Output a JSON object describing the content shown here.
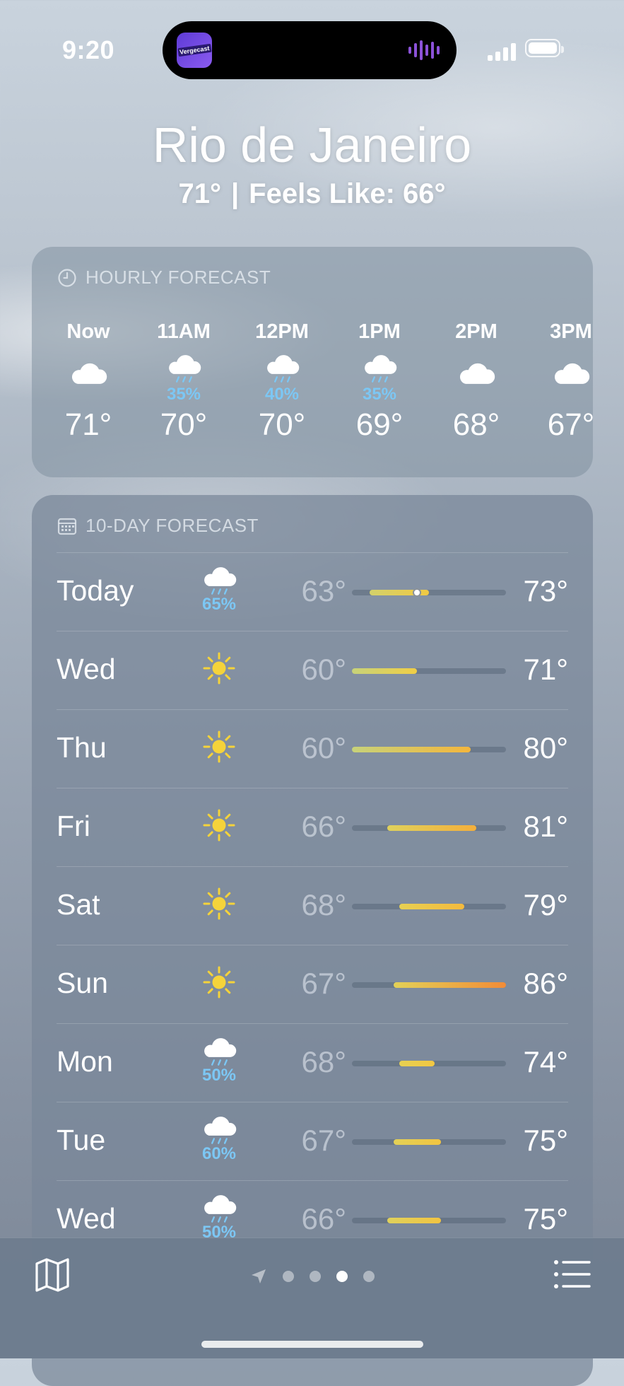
{
  "status_bar": {
    "time": "9:20",
    "live_activity_app": "Vergecast"
  },
  "location": {
    "city": "Rio de Janeiro",
    "current_temp": "71°",
    "separator": "|",
    "feels_like": "Feels Like: 66°"
  },
  "hourly": {
    "title": "HOURLY FORECAST",
    "icon": "clock-icon",
    "items": [
      {
        "label": "Now",
        "icon": "cloud-icon",
        "pop": "",
        "temp": "71°"
      },
      {
        "label": "11AM",
        "icon": "cloud-rain-icon",
        "pop": "35%",
        "temp": "70°"
      },
      {
        "label": "12PM",
        "icon": "cloud-rain-icon",
        "pop": "40%",
        "temp": "70°"
      },
      {
        "label": "1PM",
        "icon": "cloud-rain-icon",
        "pop": "35%",
        "temp": "69°"
      },
      {
        "label": "2PM",
        "icon": "cloud-icon",
        "pop": "",
        "temp": "68°"
      },
      {
        "label": "3PM",
        "icon": "cloud-icon",
        "pop": "",
        "temp": "67°"
      }
    ]
  },
  "daily": {
    "title": "10-DAY FORECAST",
    "icon": "calendar-icon",
    "range_min": 60,
    "range_max": 86,
    "days": [
      {
        "day": "Today",
        "icon": "cloud-rain-icon",
        "pop": "65%",
        "low": "63°",
        "high": "73°",
        "low_v": 63,
        "high_v": 73,
        "current_v": 71
      },
      {
        "day": "Wed",
        "icon": "sun-icon",
        "pop": "",
        "low": "60°",
        "high": "71°",
        "low_v": 60,
        "high_v": 71
      },
      {
        "day": "Thu",
        "icon": "sun-icon",
        "pop": "",
        "low": "60°",
        "high": "80°",
        "low_v": 60,
        "high_v": 80
      },
      {
        "day": "Fri",
        "icon": "sun-icon",
        "pop": "",
        "low": "66°",
        "high": "81°",
        "low_v": 66,
        "high_v": 81
      },
      {
        "day": "Sat",
        "icon": "sun-icon",
        "pop": "",
        "low": "68°",
        "high": "79°",
        "low_v": 68,
        "high_v": 79
      },
      {
        "day": "Sun",
        "icon": "sun-icon",
        "pop": "",
        "low": "67°",
        "high": "86°",
        "low_v": 67,
        "high_v": 86
      },
      {
        "day": "Mon",
        "icon": "cloud-rain-icon",
        "pop": "50%",
        "low": "68°",
        "high": "74°",
        "low_v": 68,
        "high_v": 74
      },
      {
        "day": "Tue",
        "icon": "cloud-rain-icon",
        "pop": "60%",
        "low": "67°",
        "high": "75°",
        "low_v": 67,
        "high_v": 75
      },
      {
        "day": "Wed",
        "icon": "cloud-rain-icon",
        "pop": "50%",
        "low": "66°",
        "high": "75°",
        "low_v": 66,
        "high_v": 75
      }
    ]
  },
  "bottom_bar": {
    "map_icon": "map-icon",
    "list_icon": "list-icon",
    "page_count": 4,
    "current_page": 3
  },
  "colors": {
    "rain": "#7cc7f4",
    "sun": "#f5d33a",
    "cool": "#c7d27a",
    "warm": "#f29a3a"
  }
}
